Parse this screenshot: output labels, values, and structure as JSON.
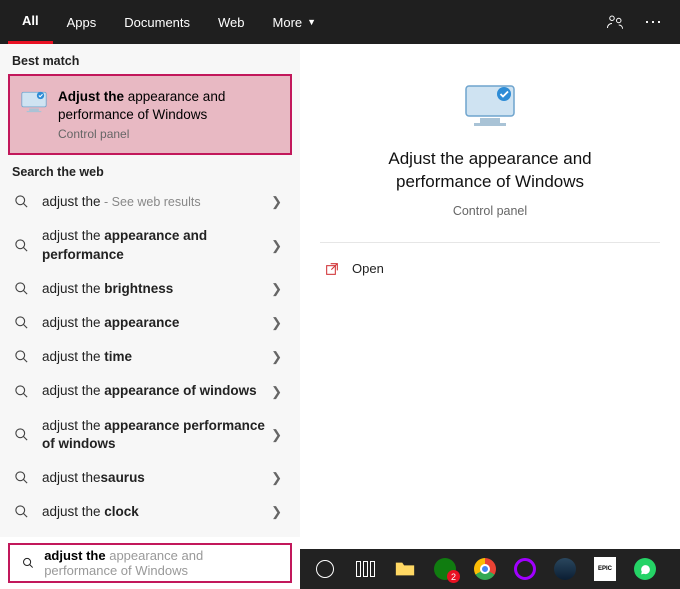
{
  "tabs": {
    "items": [
      {
        "label": "All",
        "active": true
      },
      {
        "label": "Apps",
        "active": false
      },
      {
        "label": "Documents",
        "active": false
      },
      {
        "label": "Web",
        "active": false
      },
      {
        "label": "More",
        "active": false,
        "dropdown": true
      }
    ]
  },
  "sections": {
    "best_match_header": "Best match",
    "web_header": "Search the web"
  },
  "best_match": {
    "title_bold": "Adjust the",
    "title_rest": " appearance and performance of Windows",
    "subtitle": "Control panel"
  },
  "web_results": [
    {
      "prefix": "adjust the",
      "bold": "",
      "hint": " - See web results"
    },
    {
      "prefix": "adjust the ",
      "bold": "appearance and performance",
      "hint": ""
    },
    {
      "prefix": "adjust the ",
      "bold": "brightness",
      "hint": ""
    },
    {
      "prefix": "adjust the ",
      "bold": "appearance",
      "hint": ""
    },
    {
      "prefix": "adjust the ",
      "bold": "time",
      "hint": ""
    },
    {
      "prefix": "adjust the ",
      "bold": "appearance of windows",
      "hint": ""
    },
    {
      "prefix": "adjust the ",
      "bold": "appearance performance of windows",
      "hint": ""
    },
    {
      "prefix": "adjust the",
      "bold": "saurus",
      "hint": ""
    },
    {
      "prefix": "adjust the ",
      "bold": "clock",
      "hint": ""
    }
  ],
  "preview": {
    "title": "Adjust the appearance and performance of Windows",
    "subtitle": "Control panel",
    "open_label": "Open"
  },
  "search": {
    "typed": "adjust the ",
    "completion": "appearance and performance of Windows"
  },
  "taskbar": {
    "items": [
      "cortana",
      "task-view",
      "file-explorer",
      "xbox",
      "chrome",
      "opera",
      "steam",
      "epic",
      "whatsapp"
    ]
  }
}
